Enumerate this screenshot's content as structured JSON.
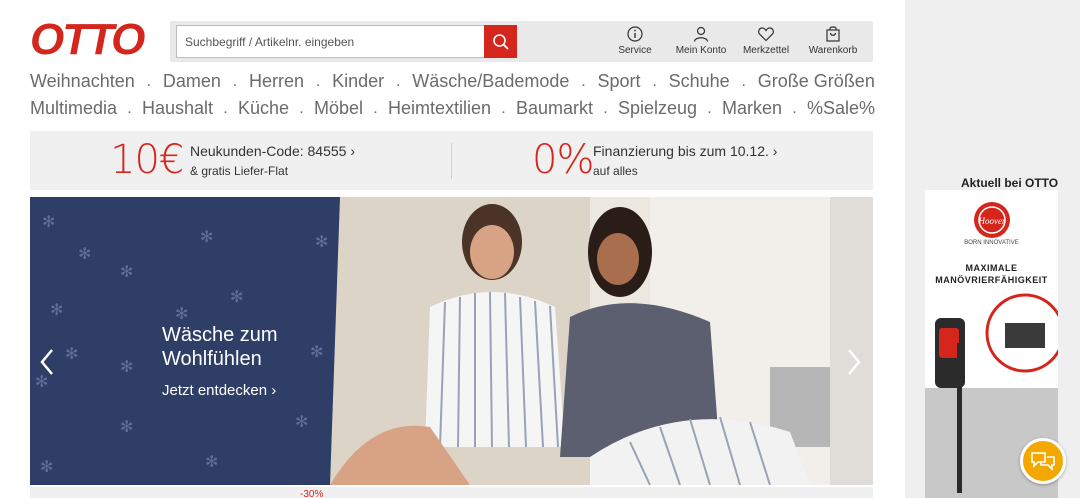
{
  "brand": {
    "name": "OTTO",
    "color": "#d4261c"
  },
  "search": {
    "placeholder": "Suchbegriff / Artikelnr. eingeben",
    "value": ""
  },
  "header_icons": [
    {
      "label": "Service",
      "icon": "info-icon"
    },
    {
      "label": "Mein Konto",
      "icon": "user-icon"
    },
    {
      "label": "Merkzettel",
      "icon": "heart-icon"
    },
    {
      "label": "Warenkorb",
      "icon": "bag-icon"
    }
  ],
  "nav": {
    "row1": [
      "Weihnachten",
      "Damen",
      "Herren",
      "Kinder",
      "Wäsche/Bademode",
      "Sport",
      "Schuhe",
      "Große Größen"
    ],
    "row2": [
      "Multimedia",
      "Haushalt",
      "Küche",
      "Möbel",
      "Heimtextilien",
      "Baumarkt",
      "Spielzeug",
      "Marken",
      "%Sale%"
    ]
  },
  "promo": {
    "left": {
      "big": "10€",
      "title": "Neukunden-Code: 84555 ›",
      "sub": "& gratis Liefer-Flat"
    },
    "right": {
      "big": "0%",
      "title": "Finanzierung bis zum 10.12. ›",
      "sub": "auf alles"
    }
  },
  "hero": {
    "title": "Wäsche zum Wohlfühlen",
    "cta": "Jetzt entdecken ›"
  },
  "ad": {
    "caption": "Aktuell bei OTTO",
    "brand_tag": "BORN INNOVATIVE",
    "headline": "MAXIMALE MANÖVRIERFÄHIGKEIT"
  },
  "bottom_partial": "-30%",
  "colors": {
    "accent": "#d4261c",
    "chat": "#f3a800",
    "hero_dark": "#2e3e66"
  }
}
